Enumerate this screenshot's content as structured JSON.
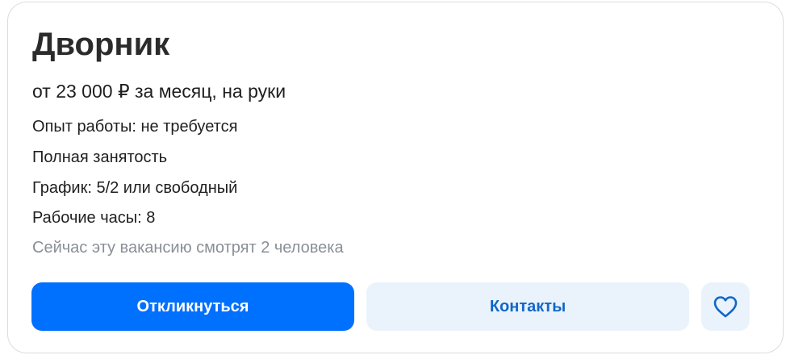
{
  "vacancy": {
    "title": "Дворник",
    "salary": "от 23 000 ₽ за месяц, на руки",
    "experience": "Опыт работы: не требуется",
    "employment": "Полная занятость",
    "schedule": "График: 5/2 или свободный",
    "hours": "Рабочие часы: 8",
    "viewers": "Сейчас эту вакансию смотрят 2 человека"
  },
  "actions": {
    "respond_label": "Откликнуться",
    "contacts_label": "Контакты",
    "favorite_icon": "heart-icon"
  },
  "colors": {
    "primary": "#0070ff",
    "secondary_bg": "#eaf3fc",
    "secondary_text": "#1266c7",
    "muted_text": "#8a8f96"
  }
}
